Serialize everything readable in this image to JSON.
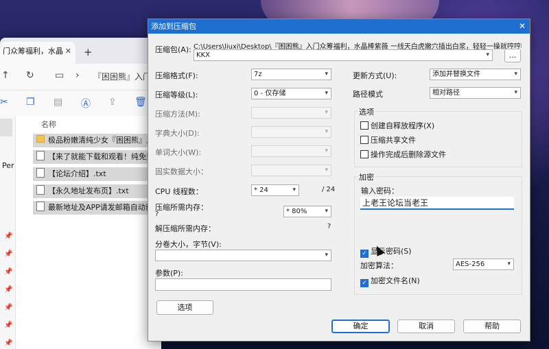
{
  "explorer": {
    "tab_title": "门众筹福利，水晶",
    "tab_close": "✕",
    "new_tab": "+",
    "breadcrumb": "『困困熊』入门",
    "left_label": "Per",
    "column_name": "名称",
    "files": [
      {
        "name": "极品粉嫩清纯少女『困困熊』入门",
        "type": "folder"
      },
      {
        "name": "【来了就能下载和观看！纯免费！",
        "type": "file"
      },
      {
        "name": "【论坛介绍】.txt",
        "type": "file"
      },
      {
        "name": "【永久地址发布页】.txt",
        "type": "file"
      },
      {
        "name": "最新地址及APP请发邮箱自动获取",
        "type": "file"
      }
    ]
  },
  "dialog": {
    "title": "添加到压缩包",
    "close": "✕",
    "archive": {
      "label": "压缩包(A):",
      "path": "C:\\Users\\liuxi\\Desktop\\『困困熊』入门众筹福利，水晶棒紫薇 一线天白虎嫩穴插出白浆，轻轻一操就哼哼唧唧",
      "name_value": "KKX",
      "browse_label": "..."
    },
    "format": {
      "label": "压缩格式(F):",
      "value": "7z"
    },
    "level": {
      "label": "压缩等级(L):",
      "value": "0 - 仅存储"
    },
    "method": {
      "label": "压缩方法(M):",
      "value": ""
    },
    "dict_size": {
      "label": "字典大小(D):",
      "value": ""
    },
    "word_size": {
      "label": "单词大小(W):",
      "value": ""
    },
    "solid_size": {
      "label": "固实数据大小：",
      "value": ""
    },
    "threads": {
      "label": "CPU 线程数：",
      "value": "* 24",
      "max": "/ 24"
    },
    "mem_compress": {
      "label": "压缩所需内存：",
      "sub": "?",
      "value": "* 80%"
    },
    "mem_decompress": {
      "label": "解压缩所需内存：",
      "value": "?"
    },
    "volume": {
      "label": "分卷大小，字节(V):",
      "value": ""
    },
    "params": {
      "label": "参数(P):",
      "value": ""
    },
    "options_button": "选项",
    "update_mode": {
      "label": "更新方式(U):",
      "value": "添加并替换文件"
    },
    "path_mode": {
      "label": "路径模式",
      "value": "相对路径"
    },
    "options_group": {
      "title": "选项",
      "sfx": "创建自释放程序(X)",
      "shared": "压缩共享文件",
      "delete": "操作完成后删除源文件"
    },
    "encryption": {
      "title": "加密",
      "password_label": "输入密码：",
      "password_value": "上老王论坛当老王",
      "show_password": "显示密码(S)",
      "method_label": "加密算法：",
      "method_value": "AES-256",
      "encrypt_names": "加密文件名(N)"
    },
    "ok": "确定",
    "cancel": "取消",
    "help": "帮助"
  }
}
